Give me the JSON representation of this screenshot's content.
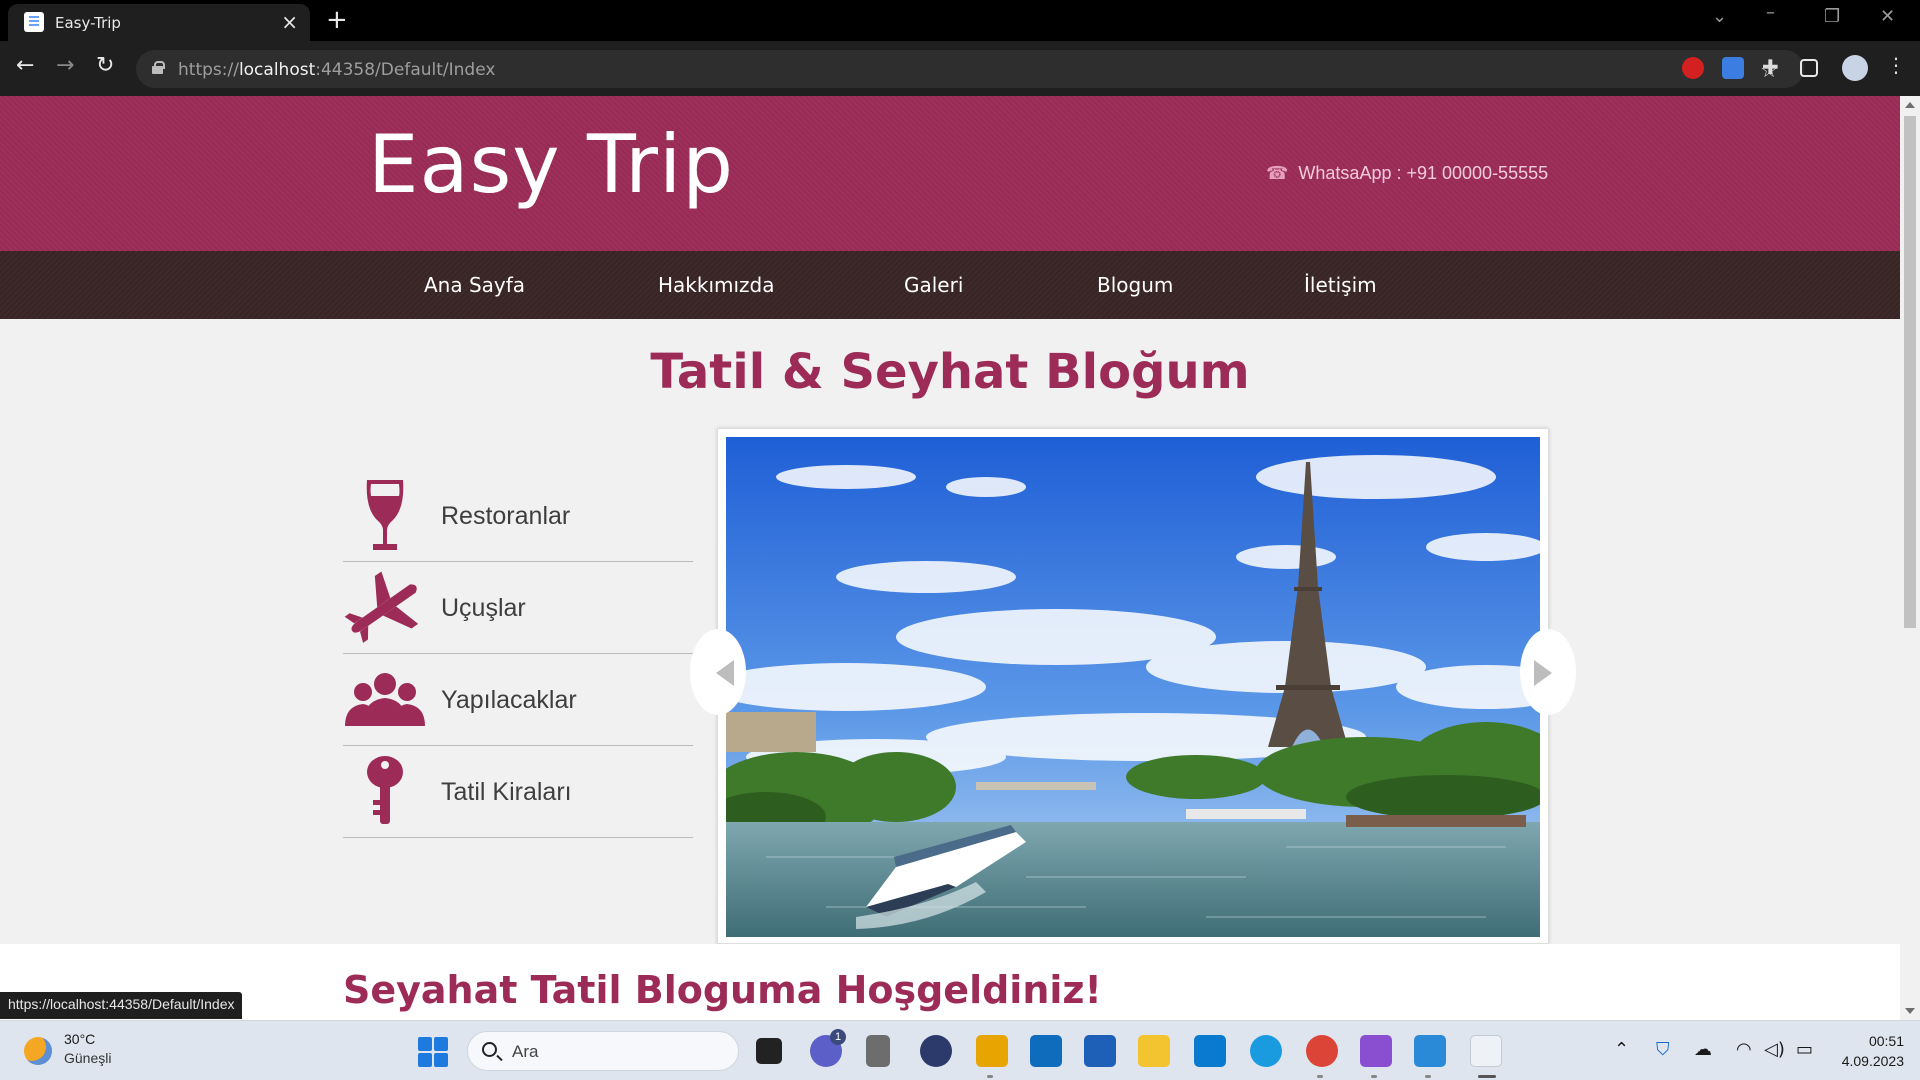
{
  "browser": {
    "tab_title": "Easy-Trip",
    "url_prefix": "https://",
    "url_host": "localhost",
    "url_rest": ":44358/Default/Index",
    "status_url": "https://localhost:44358/Default/Index"
  },
  "site": {
    "logo": "Easy Trip",
    "contact": "WhatsaApp : +91 00000-55555",
    "nav": [
      "Ana Sayfa",
      "Hakkımızda",
      "Galeri",
      "Blogum",
      "İletişim"
    ],
    "page_title": "Tatil & Seyhat Bloğum",
    "services": [
      {
        "label": "Restoranlar",
        "icon": "wine-glass-icon"
      },
      {
        "label": "Uçuşlar",
        "icon": "airplane-icon"
      },
      {
        "label": "Yapılacaklar",
        "icon": "people-icon"
      },
      {
        "label": "Tatil Kiraları",
        "icon": "key-icon"
      }
    ],
    "welcome_heading": "Seyahat Tatil Bloguma Hoşgeldiniz!",
    "accent_color": "#9c2c57",
    "nav_bg_color": "#3a2626"
  },
  "taskbar": {
    "weather_temp": "30°C",
    "weather_desc": "Güneşli",
    "search_placeholder": "Ara",
    "time": "00:51",
    "date": "4.09.2023",
    "chat_badge": "1"
  }
}
